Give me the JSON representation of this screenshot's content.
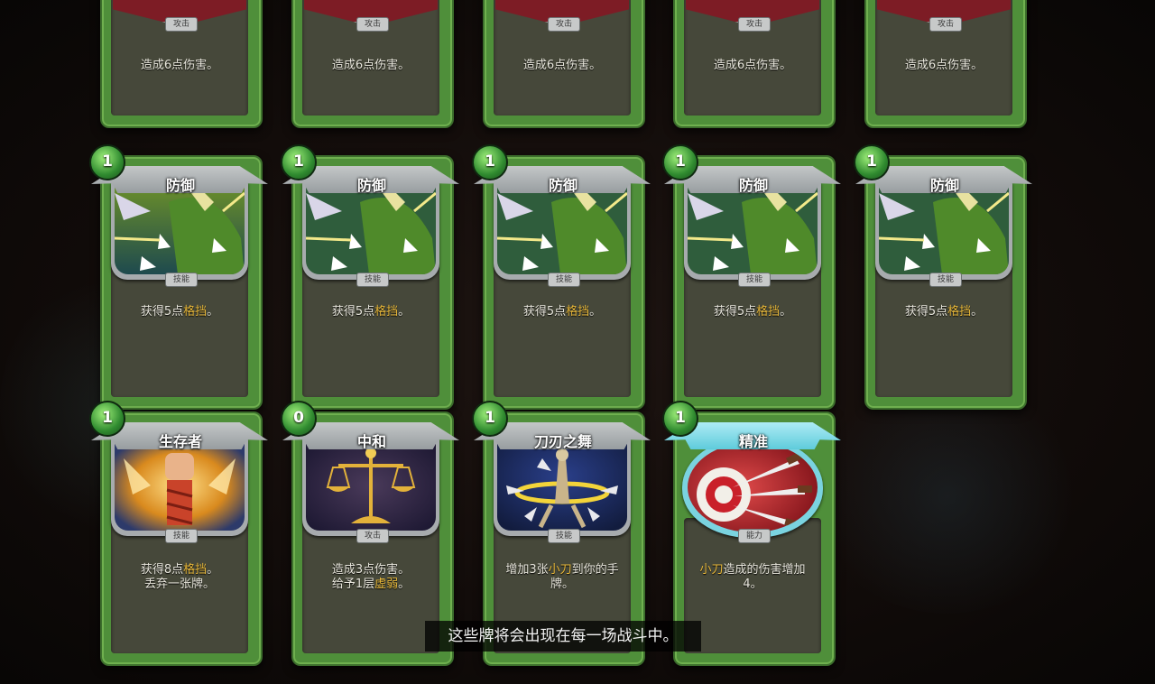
{
  "caption": "这些牌将会出现在每一场战斗中。",
  "rows": {
    "row1": [
      {
        "type": "攻击",
        "desc": "造成6点伤害。"
      },
      {
        "type": "攻击",
        "desc": "造成6点伤害。"
      },
      {
        "type": "攻击",
        "desc": "造成6点伤害。"
      },
      {
        "type": "攻击",
        "desc": "造成6点伤害。"
      },
      {
        "type": "攻击",
        "desc": "造成6点伤害。"
      }
    ],
    "row2": [
      {
        "cost": "1",
        "title": "防御",
        "type": "技能",
        "desc_pre": "获得5点",
        "desc_kw": "格挡",
        "desc_post": "。"
      },
      {
        "cost": "1",
        "title": "防御",
        "type": "技能",
        "desc_pre": "获得5点",
        "desc_kw": "格挡",
        "desc_post": "。"
      },
      {
        "cost": "1",
        "title": "防御",
        "type": "技能",
        "desc_pre": "获得5点",
        "desc_kw": "格挡",
        "desc_post": "。"
      },
      {
        "cost": "1",
        "title": "防御",
        "type": "技能",
        "desc_pre": "获得5点",
        "desc_kw": "格挡",
        "desc_post": "。"
      },
      {
        "cost": "1",
        "title": "防御",
        "type": "技能",
        "desc_pre": "获得5点",
        "desc_kw": "格挡",
        "desc_post": "。"
      }
    ],
    "row3": [
      {
        "cost": "1",
        "title": "生存者",
        "type": "技能",
        "line1_pre": "获得8点",
        "line1_kw": "格挡",
        "line1_post": "。",
        "line2": "丢弃一张牌。"
      },
      {
        "cost": "0",
        "title": "中和",
        "type": "攻击",
        "line1": "造成3点伤害。",
        "line2_pre": "给予1层",
        "line2_kw": "虚弱",
        "line2_post": "。"
      },
      {
        "cost": "1",
        "title": "刀刃之舞",
        "type": "技能",
        "line1_pre": "增加3张",
        "line1_kw": "小刀",
        "line1_post": "到你的手",
        "line2": "牌。"
      },
      {
        "cost": "1",
        "title": "精准",
        "type": "能力",
        "line1_kw": "小刀",
        "line1_post": "造成的伤害增加",
        "line2": "4。"
      }
    ]
  },
  "colors": {
    "card_green": "#4f8f3a",
    "keyword_gold": "#e8b83a",
    "power_banner": "#4fc5d6"
  },
  "icons": {
    "defend_art": "shield-shards-icon",
    "survivor_art": "fist-icon",
    "neutralize_art": "scales-icon",
    "blade_dance_art": "dancer-blades-icon",
    "accuracy_art": "knives-target-icon"
  }
}
